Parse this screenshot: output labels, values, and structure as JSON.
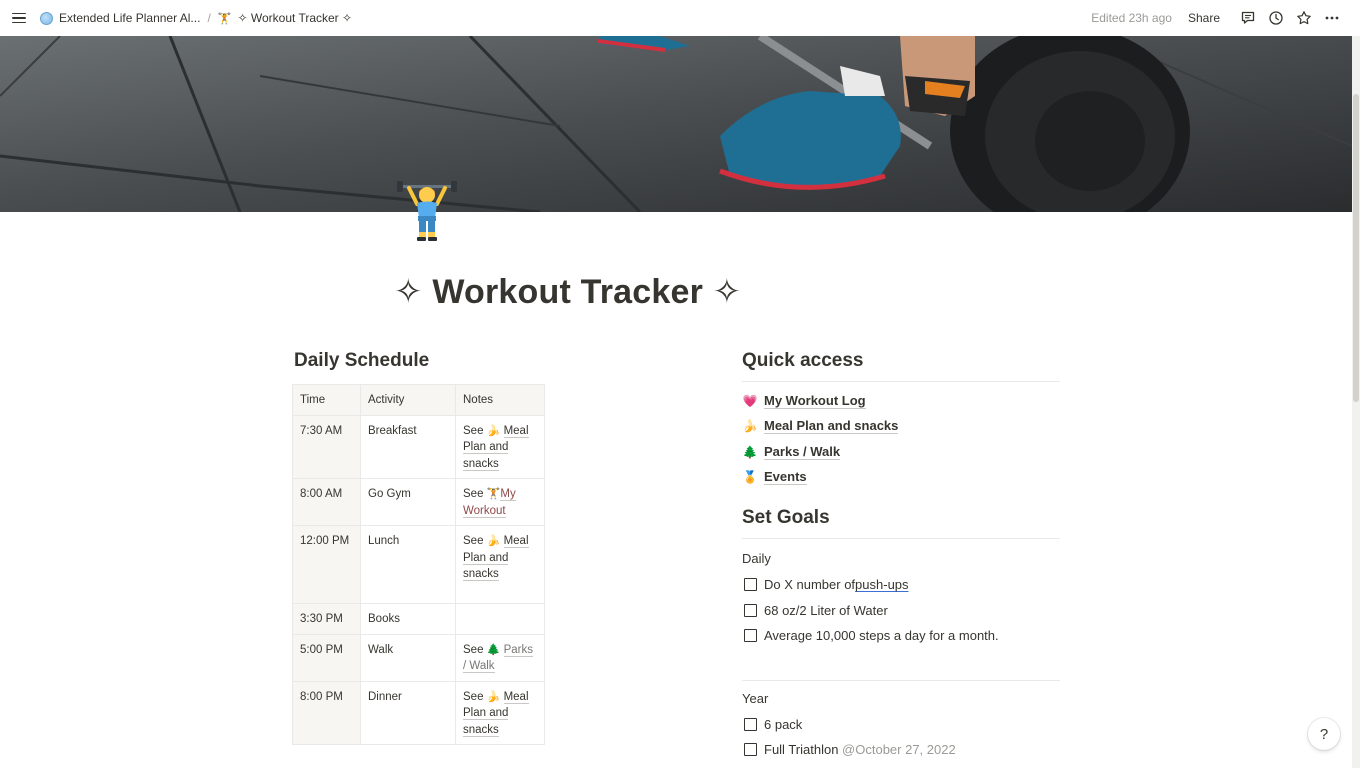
{
  "topbar": {
    "breadcrumb_parent": "Extended Life Planner Al...",
    "breadcrumb_separator": "/",
    "breadcrumb_current_emoji": "🏋️",
    "breadcrumb_current": "✧ Workout Tracker ✧",
    "edited": "Edited 23h ago",
    "share": "Share"
  },
  "page": {
    "icon": "woman-lifting-weights-icon",
    "title": "✧ Workout Tracker ✧"
  },
  "schedule": {
    "heading": "Daily Schedule",
    "columns": [
      "Time",
      "Activity",
      "Notes"
    ],
    "rows": [
      {
        "time": "7:30 AM",
        "activity": "Breakfast",
        "see": "See",
        "emoji": "🍌",
        "link": "Meal Plan and snacks",
        "style": "normal"
      },
      {
        "time": "8:00 AM",
        "activity": "Go Gym",
        "see": "See",
        "emoji": "🏋️",
        "link": "My Workout",
        "style": "red"
      },
      {
        "time": "12:00 PM",
        "activity": "Lunch",
        "see": "See",
        "emoji": "🍌",
        "link": "Meal Plan and snacks",
        "style": "normal"
      },
      {
        "time": "3:30 PM",
        "activity": "Books",
        "see": "",
        "emoji": "",
        "link": "",
        "style": ""
      },
      {
        "time": "5:00 PM",
        "activity": "Walk",
        "see": "See",
        "emoji": "🌲",
        "link": "Parks / Walk",
        "style": "gray"
      },
      {
        "time": "8:00 PM",
        "activity": "Dinner",
        "see": "See",
        "emoji": "🍌",
        "link": "Meal Plan and snacks",
        "style": "normal"
      }
    ]
  },
  "quick_access": {
    "heading": "Quick access",
    "items": [
      {
        "emoji": "💗",
        "label": "My Workout Log"
      },
      {
        "emoji": "🍌",
        "label": "Meal Plan and snacks"
      },
      {
        "emoji": "🌲",
        "label": "Parks / Walk"
      },
      {
        "emoji": "🏅",
        "label": "Events"
      }
    ]
  },
  "goals": {
    "heading": "Set Goals",
    "daily_label": "Daily",
    "daily": [
      {
        "prefix": "Do X number of ",
        "underlined": "push-ups"
      },
      {
        "prefix": "68 oz/2 Liter of Water",
        "underlined": ""
      },
      {
        "prefix": "Average 10,000 steps a day for a month.",
        "underlined": ""
      }
    ],
    "year_label": "Year",
    "year": [
      {
        "text": "6 pack",
        "mention": ""
      },
      {
        "text": "Full Triathlon ",
        "mention": "@October 27, 2022"
      }
    ]
  },
  "help": "?"
}
